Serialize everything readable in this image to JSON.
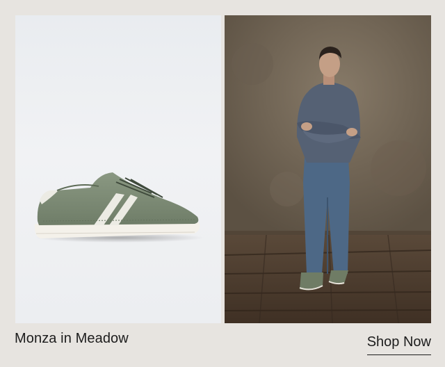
{
  "product": {
    "name": "Monza in Meadow",
    "cta_label": "Shop Now"
  },
  "colors": {
    "background": "#e7e4e0",
    "shoe_suede": "#7f8d78",
    "shoe_sole": "#f4f1ea",
    "text": "#1c1c1c"
  },
  "images": {
    "left": "sneaker-product-image",
    "right": "model-lifestyle-image"
  }
}
